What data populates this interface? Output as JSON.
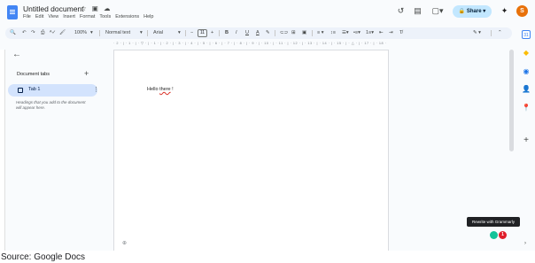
{
  "app": {
    "title": "Untitled document",
    "title_icons": "☆ ▣ ☁",
    "menu": [
      "File",
      "Edit",
      "View",
      "Insert",
      "Format",
      "Tools",
      "Extensions",
      "Help"
    ]
  },
  "header": {
    "history_icon": "↺",
    "comments_icon": "▤",
    "meet_icon": "▢▾",
    "share_label": "🔒 Share  ▾",
    "gemini_icon": "✦",
    "avatar_letter": "S"
  },
  "toolbar": {
    "search_icon": "🔍",
    "undo_icon": "↶",
    "redo_icon": "↷",
    "print_icon": "⎙",
    "spell_icon": "ᴬ✓",
    "paint_icon": "🖌",
    "zoom": "100%",
    "style": "Normal text",
    "font": "Arial",
    "font_size": "11",
    "minus": "−",
    "plus": "+",
    "bold": "B",
    "italic": "I",
    "underline": "U",
    "text_color": "A",
    "highlight": "✎",
    "link": "⊂⊃",
    "comment": "⊞",
    "image": "▣",
    "align": "≡ ▾",
    "line_spacing": "↕≡",
    "checklist": "☰▾",
    "bullets": "•≡▾",
    "numbered": "1≡▾",
    "indent_less": "⇤",
    "indent_more": "⇥",
    "clear_format": "T̸",
    "edit_mode": "✎ ▾",
    "collapse": "⌃"
  },
  "ruler_text": "· 2 · | · 1 · | · ▽ · | · 1 · | · 2 · | · 3 · | · 4 · | · 5 · | · 6 · | · 7 · | · 8 · | · 9 · | · 10 · | · 11 · | · 12 · | · 13 · | · 14 · | · 15 · | · △ · | · 17 · | · 18 ·",
  "tabs_panel": {
    "back_icon": "←",
    "heading": "Document tabs",
    "add_icon": "+",
    "tab_label": "Tab 1",
    "tab_more_icon": "⋮",
    "hint": "Headings that you add to the document will appear here."
  },
  "document": {
    "text_plain": "Hello ",
    "text_misspelled": "there",
    "text_end": " !",
    "footer_icon": "⊕"
  },
  "side_panel": {
    "keep_icon": "◆",
    "tasks_icon": "◉",
    "contacts_icon": "👤",
    "maps_icon": "📍",
    "add_icon": "+"
  },
  "grammarly": {
    "tooltip": "Rewrite with Grammarly",
    "badge": "1"
  },
  "expand_icon": "›",
  "caption": "Source: Google Docs",
  "colors": {
    "share": "#c2e7ff",
    "tab_active": "#d3e3fd",
    "avatar": "#e8710a",
    "grammarly": "#15c39a",
    "badge": "#e01e2b"
  }
}
